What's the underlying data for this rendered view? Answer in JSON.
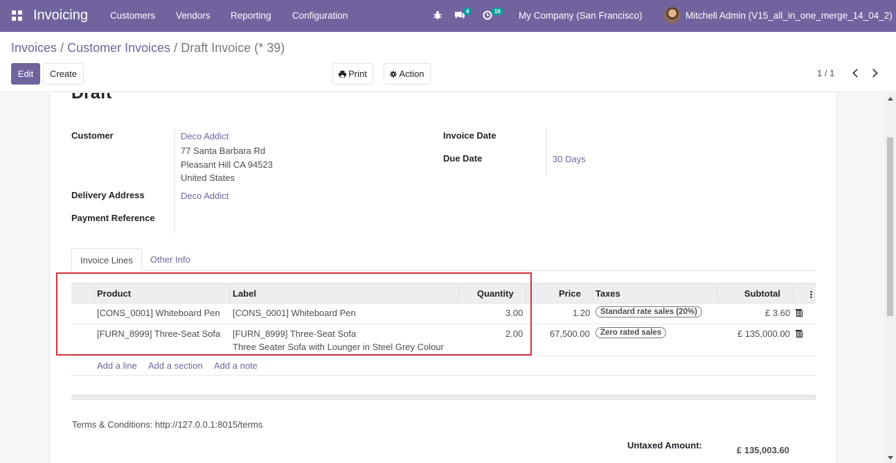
{
  "navbar": {
    "app_title": "Invoicing",
    "menu": [
      "Customers",
      "Vendors",
      "Reporting",
      "Configuration"
    ],
    "messages_count": "4",
    "activities_count": "16",
    "company": "My Company (San Francisco)",
    "user": "Mitchell Admin (V15_all_in_one_merge_14_04_2)"
  },
  "breadcrumb": {
    "level1": "Invoices",
    "level2": "Customer Invoices",
    "current": "Draft Invoice (* 39)",
    "sep": "/"
  },
  "toolbar": {
    "edit": "Edit",
    "create": "Create",
    "print": "Print",
    "action": "Action",
    "pager": "1 / 1"
  },
  "invoice": {
    "state": "Draft",
    "customer_label": "Customer",
    "customer_name": "Deco Addict",
    "address_line1": "77 Santa Barbara Rd",
    "address_line2": "Pleasant Hill CA 94523",
    "address_line3": "United States",
    "delivery_label": "Delivery Address",
    "delivery_value": "Deco Addict",
    "payment_ref_label": "Payment Reference",
    "invoice_date_label": "Invoice Date",
    "due_date_label": "Due Date",
    "due_date_value": "30 Days"
  },
  "tabs": {
    "lines": "Invoice Lines",
    "other": "Other Info"
  },
  "table": {
    "headers": {
      "product": "Product",
      "label": "Label",
      "quantity": "Quantity",
      "price": "Price",
      "taxes": "Taxes",
      "subtotal": "Subtotal"
    },
    "rows": [
      {
        "product": "[CONS_0001] Whiteboard Pen",
        "label": "[CONS_0001] Whiteboard Pen",
        "label2": "",
        "quantity": "3.00",
        "price": "1.20",
        "tax": "Standard rate sales (20%)",
        "subtotal": "£ 3.60"
      },
      {
        "product": "[FURN_8999] Three-Seat Sofa",
        "label": "[FURN_8999] Three-Seat Sofa",
        "label2": "Three Seater Sofa with Lounger in Steel Grey Colour",
        "quantity": "2.00",
        "price": "67,500.00",
        "tax": "Zero rated sales",
        "subtotal": "£ 135,000.00"
      }
    ],
    "add_line": "Add a line",
    "add_section": "Add a section",
    "add_note": "Add a note"
  },
  "footer": {
    "terms": "Terms & Conditions: http://127.0.0.1:8015/terms",
    "untaxed_label": "Untaxed Amount:",
    "untaxed_value": "£ 135,003.60"
  },
  "colors": {
    "brand": "#71639e",
    "badge": "#00a09d",
    "highlight": "#d0303a"
  }
}
